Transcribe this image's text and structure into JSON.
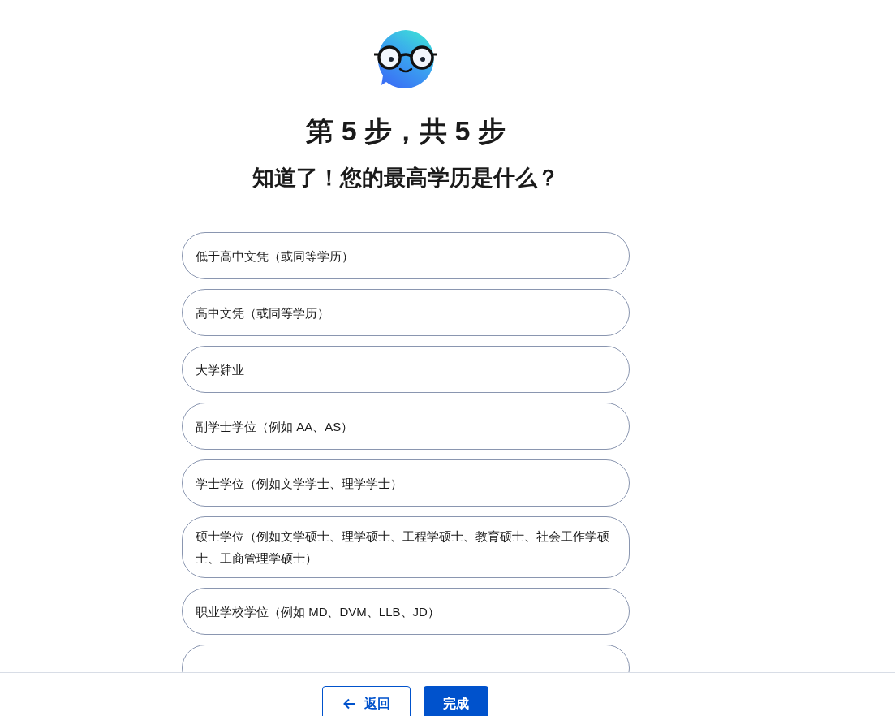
{
  "step_title": "第 5 步，共 5 步",
  "question": "知道了！您的最高学历是什么？",
  "options": [
    {
      "label": "低于高中文凭（或同等学历）",
      "selected": false
    },
    {
      "label": "高中文凭（或同等学历）",
      "selected": false
    },
    {
      "label": "大学肄业",
      "selected": false
    },
    {
      "label": "副学士学位（例如 AA、AS）",
      "selected": false
    },
    {
      "label": "学士学位（例如文学学士、理学学士）",
      "selected": false
    },
    {
      "label": "硕士学位（例如文学硕士、理学硕士、工程学硕士、教育硕士、社会工作学硕士、工商管理学硕士）",
      "selected": false
    },
    {
      "label": "职业学校学位（例如 MD、DVM、LLB、JD）",
      "selected": false
    }
  ],
  "footer": {
    "back_button": "返回",
    "finish_button": "完成"
  }
}
